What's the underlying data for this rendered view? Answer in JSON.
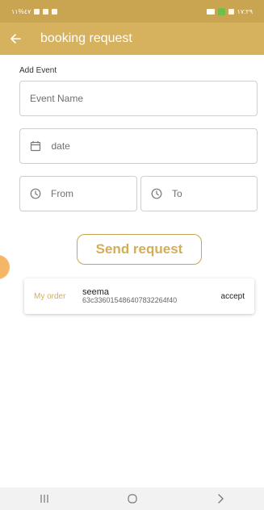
{
  "status_bar": {
    "left_text": "٤٧%١١",
    "right_text": "١٧:٢٩"
  },
  "app_bar": {
    "title": "booking request",
    "back_icon": "arrow-left-icon"
  },
  "form": {
    "section_label": "Add Event",
    "event_name_placeholder": "Event Name",
    "date_placeholder": "date",
    "from_placeholder": "From",
    "to_placeholder": "To"
  },
  "send_button": {
    "label": "Send request"
  },
  "orders": [
    {
      "label": "My order",
      "name": "seema",
      "id": "63c336015486407832264f40",
      "action": "accept"
    }
  ],
  "colors": {
    "accent": "#d6b15e",
    "status_bar": "#c9a552",
    "button_text": "#d4ad57"
  }
}
